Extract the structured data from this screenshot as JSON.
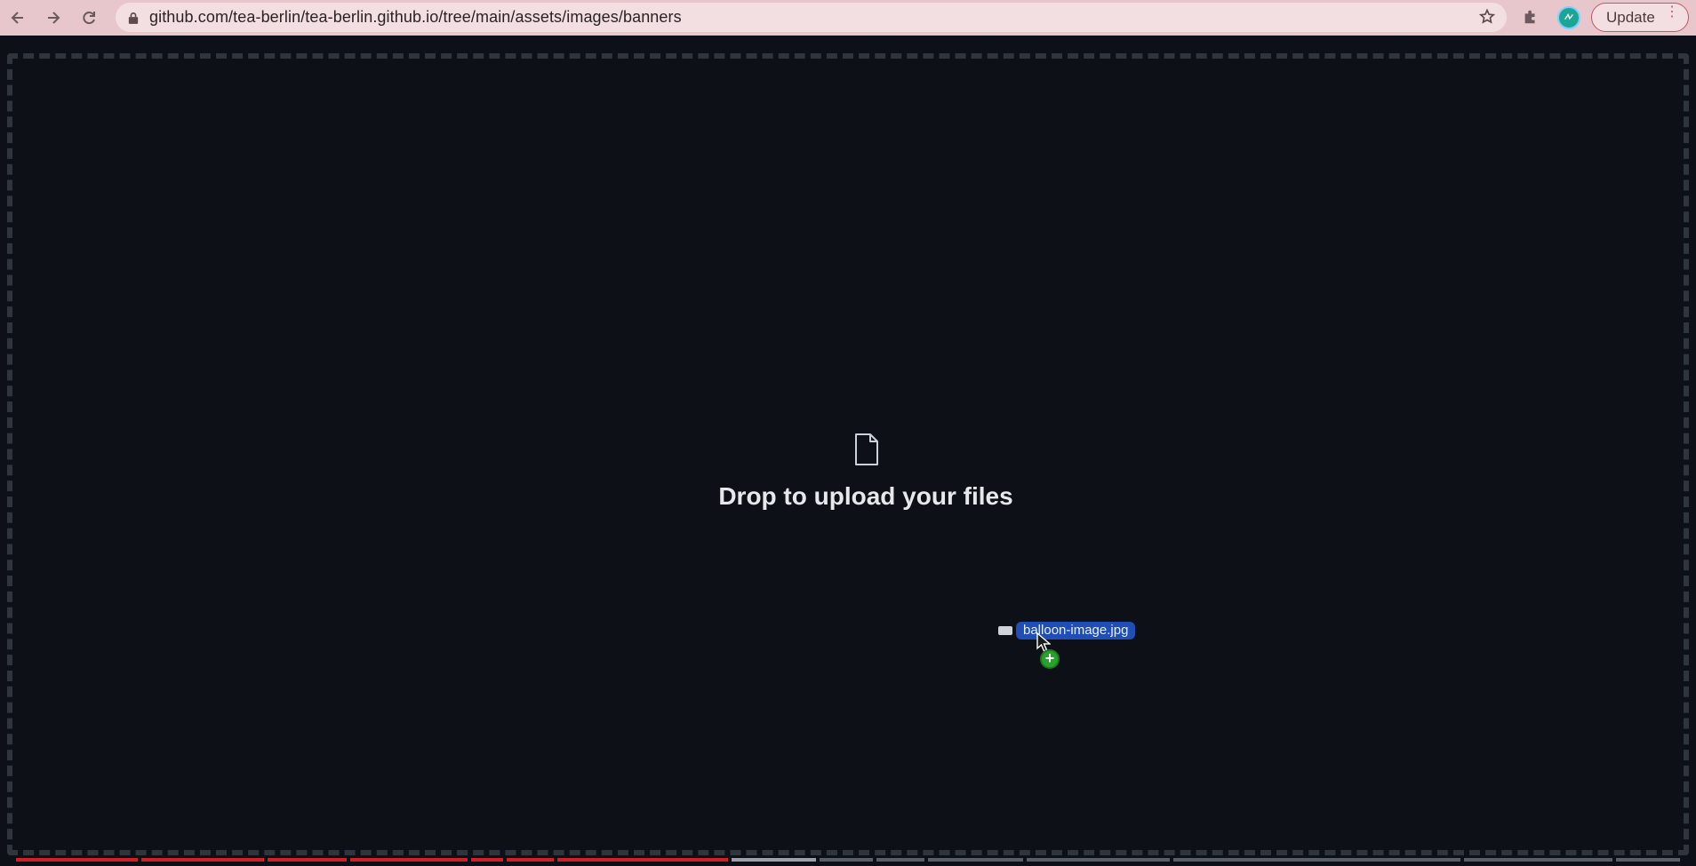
{
  "browser": {
    "url": "github.com/tea-berlin/tea-berlin.github.io/tree/main/assets/images/banners",
    "update_label": "Update",
    "icons": [
      "back-arrow-icon",
      "forward-arrow-icon",
      "reload-icon",
      "lock-icon",
      "star-icon",
      "extensions-puzzle-icon",
      "profile-avatar-icon",
      "more-vert-icon"
    ]
  },
  "dropzone": {
    "message": "Drop to upload your files",
    "icon": "file-icon"
  },
  "drag": {
    "filename": "balloon-image.jpg",
    "badge": "+"
  },
  "video_progress": {
    "played_fraction": 0.44,
    "buffered_fraction": 0.465
  },
  "colors": {
    "chrome_bg": "#e7c7cb",
    "page_bg": "#0d1117",
    "drag_label_bg": "#1f4fb6",
    "progress_played": "#d21f26",
    "copy_badge": "#2aa12f"
  }
}
